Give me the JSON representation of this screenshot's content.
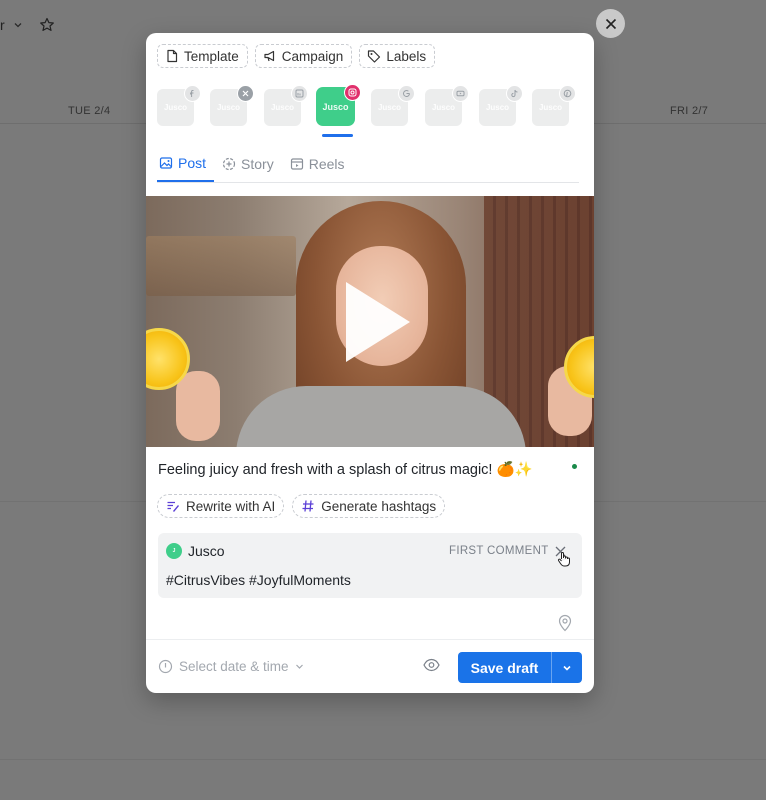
{
  "background": {
    "top_fragment": "r",
    "days": [
      "TUE 2/4",
      "FRI 2/7"
    ]
  },
  "modal": {
    "chips": [
      {
        "label": "Template",
        "icon": "document-icon"
      },
      {
        "label": "Campaign",
        "icon": "megaphone-icon"
      },
      {
        "label": "Labels",
        "icon": "tag-icon"
      }
    ],
    "accounts": [
      {
        "brand": "Jusco",
        "network": "facebook",
        "selected": false
      },
      {
        "brand": "Jusco",
        "network": "remove",
        "selected": false
      },
      {
        "brand": "Jusco",
        "network": "linkedin",
        "selected": false
      },
      {
        "brand": "Jusco",
        "network": "instagram",
        "selected": true
      },
      {
        "brand": "Jusco",
        "network": "google",
        "selected": false
      },
      {
        "brand": "Jusco",
        "network": "youtube",
        "selected": false
      },
      {
        "brand": "Jusco",
        "network": "tiktok",
        "selected": false
      },
      {
        "brand": "Jusco",
        "network": "pinterest",
        "selected": false
      }
    ],
    "tabs": [
      {
        "label": "Post",
        "active": true
      },
      {
        "label": "Story",
        "active": false
      },
      {
        "label": "Reels",
        "active": false
      }
    ],
    "caption": "Feeling juicy and fresh with a splash of citrus magic! 🍊✨",
    "ai_buttons": {
      "rewrite": "Rewrite with AI",
      "hashtags": "Generate hashtags"
    },
    "first_comment": {
      "author": "Jusco",
      "label": "FIRST COMMENT",
      "text": "#CitrusVibes #JoyfulMoments"
    },
    "footer": {
      "date_placeholder": "Select date & time",
      "save_label": "Save draft"
    }
  },
  "colors": {
    "accent": "#1a73e8",
    "brand": "#3fce8a",
    "instagram": "#e1306c"
  }
}
